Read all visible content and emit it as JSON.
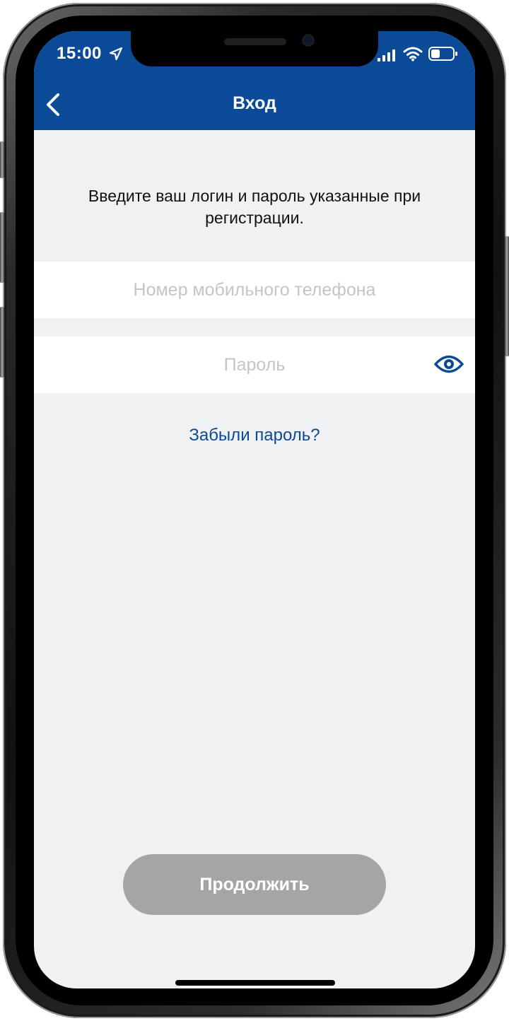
{
  "status_bar": {
    "time": "15:00",
    "icons": [
      "location-arrow-icon",
      "cellular-signal-icon",
      "wifi-icon",
      "battery-icon"
    ]
  },
  "nav": {
    "back_icon": "chevron-left-icon",
    "title": "Вход"
  },
  "instruction": "Введите ваш логин и пароль указанные при регистрации.",
  "phone_field": {
    "value": "",
    "placeholder": "Номер мобильного телефона"
  },
  "password_field": {
    "value": "",
    "placeholder": "Пароль",
    "toggle_icon": "eye-icon"
  },
  "forgot_password_link": "Забыли пароль?",
  "continue_button": {
    "label": "Продолжить",
    "state": "disabled"
  },
  "colors": {
    "header_bg": "#0a4a97",
    "screen_bg": "#f0f1f3",
    "link": "#0a4a97",
    "button_disabled": "#a5a5a5",
    "placeholder": "#c4c5c8"
  }
}
